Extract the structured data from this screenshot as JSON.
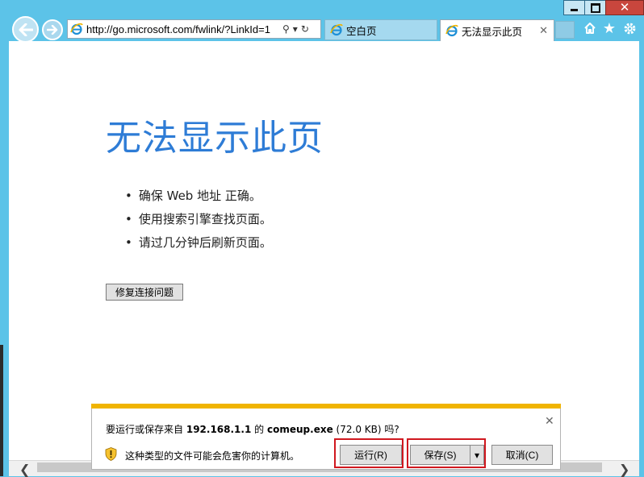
{
  "window": {
    "minimize_icon": "minimize-icon",
    "maximize_icon": "maximize-icon",
    "close_glyph": "✕"
  },
  "nav": {
    "back_icon": "back-arrow-icon",
    "forward_icon": "forward-arrow-icon"
  },
  "address_bar": {
    "url": "http://go.microsoft.com/fwlink/?LinkId=1",
    "search_glyph": "⚲",
    "dropdown_glyph": "▾",
    "refresh_glyph": "↻"
  },
  "tabs": [
    {
      "label": "空白页",
      "active": false
    },
    {
      "label": "无法显示此页",
      "active": true,
      "close_glyph": "✕"
    }
  ],
  "toolbar": {
    "home_icon": "home-icon",
    "favorites_glyph": "★",
    "settings_icon": "gear-icon"
  },
  "page": {
    "title": "无法显示此页",
    "bullets": [
      "确保 Web 地址 正确。",
      "使用搜索引擎查找页面。",
      "请过几分钟后刷新页面。"
    ],
    "fix_button": "修复连接问题"
  },
  "scrollbar": {
    "left_glyph": "❮",
    "right_glyph": "❯"
  },
  "download_bar": {
    "prefix": "要运行或保存来自",
    "host": "192.168.1.1",
    "of": "的",
    "filename": "comeup.exe",
    "size": "(72.0 KB)",
    "suffix": "吗?",
    "close_glyph": "✕",
    "warning": "这种类型的文件可能会危害你的计算机。",
    "run_button": "运行(R)",
    "save_button": "保存(S)",
    "save_dropdown_glyph": "▾",
    "cancel_button": "取消(C)",
    "highlight_color": "#d0181f",
    "accent_color": "#f0b400"
  },
  "colors": {
    "frame": "#5cc3e8",
    "title_text": "#2e7cd6"
  }
}
